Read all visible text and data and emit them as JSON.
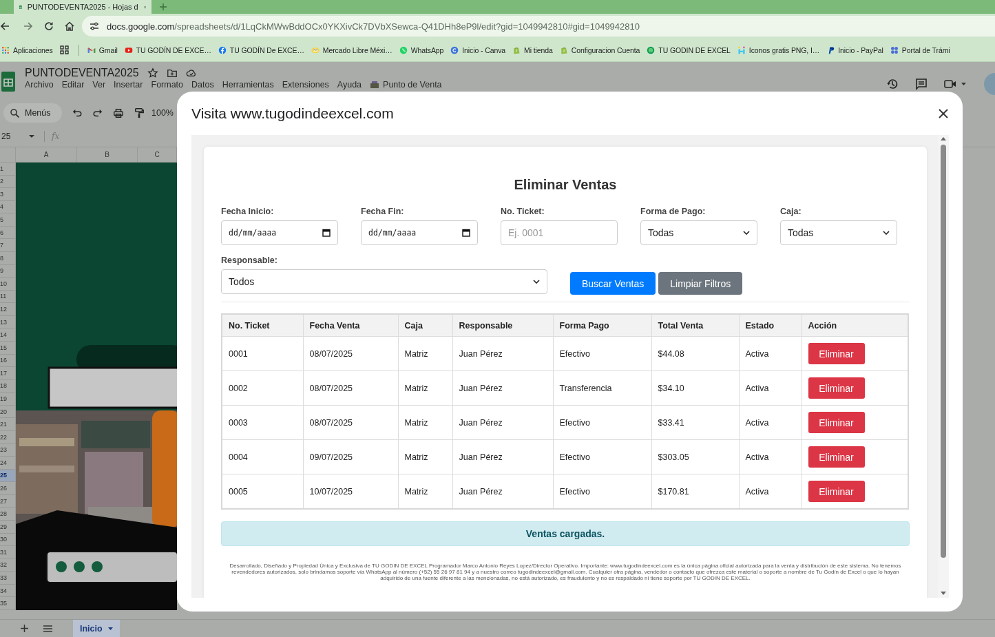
{
  "browser": {
    "tab_title": "PUNTODEVENTA2025 - Hojas d",
    "url_host": "docs.google.com",
    "url_path": "/spreadsheets/d/1LqCkMWwBddOCx0YKXivCk7DVbXSewca-Q41DHh8eP9l/edit?gid=1049942810#gid=1049942810",
    "bookmarks": [
      "Aplicaciones",
      "Gmail",
      "TU GODÍN DE EXCE…",
      "TU GODÍN De EXCE…",
      "Mercado Libre Méxi…",
      "WhatsApp",
      "Inicio - Canva",
      "Mi tienda",
      "Configuracion Cuenta",
      "TU GODIN DE EXCEL",
      "Iconos gratis PNG, I…",
      "Inicio - PayPal",
      "Portal de Trámi"
    ]
  },
  "spreadsheet": {
    "title": "PUNTODEVENTA2025",
    "menus": [
      "Archivo",
      "Editar",
      "Ver",
      "Insertar",
      "Formato",
      "Datos",
      "Herramientas",
      "Extensiones",
      "Ayuda"
    ],
    "custom_menu": "Punto de Venta",
    "search_label": "Menús",
    "zoom": "100%",
    "cell_ref": "25",
    "formula_label": "fx",
    "columns": [
      "A",
      "B",
      "C"
    ],
    "rows": [
      {
        "label": "1",
        "selected": false
      },
      {
        "label": "2",
        "selected": false
      },
      {
        "label": "3",
        "selected": false
      },
      {
        "label": "4",
        "selected": false
      },
      {
        "label": "5",
        "selected": false
      },
      {
        "label": "6",
        "selected": false
      },
      {
        "label": "7",
        "selected": false
      },
      {
        "label": "8",
        "selected": false
      },
      {
        "label": "9",
        "selected": false
      },
      {
        "label": "10",
        "selected": false
      },
      {
        "label": "11",
        "selected": false
      },
      {
        "label": "12",
        "selected": false
      },
      {
        "label": "13",
        "selected": false
      },
      {
        "label": "14",
        "selected": false
      },
      {
        "label": "15",
        "selected": false
      },
      {
        "label": "16",
        "selected": false
      },
      {
        "label": "17",
        "selected": false
      },
      {
        "label": "18",
        "selected": false
      },
      {
        "label": "19",
        "selected": false
      },
      {
        "label": "20",
        "selected": false
      },
      {
        "label": "21",
        "selected": false
      },
      {
        "label": "22",
        "selected": false
      },
      {
        "label": "23",
        "selected": false
      },
      {
        "label": "24",
        "selected": false
      },
      {
        "label": "25",
        "selected": true
      },
      {
        "label": "26",
        "selected": false
      },
      {
        "label": "27",
        "selected": false
      },
      {
        "label": "28",
        "selected": false
      },
      {
        "label": "29",
        "selected": false
      },
      {
        "label": "30",
        "selected": false
      },
      {
        "label": "31",
        "selected": false
      },
      {
        "label": "32",
        "selected": false
      },
      {
        "label": "33",
        "selected": false
      },
      {
        "label": "34",
        "selected": false
      },
      {
        "label": "35",
        "selected": false
      }
    ],
    "sheet_tabs": [
      {
        "label": "Inicio",
        "selected": true
      }
    ]
  },
  "dialog": {
    "title": "Visita www.tugodindeexcel.com",
    "panel": {
      "heading": "Eliminar Ventas",
      "filters": [
        {
          "label": "Fecha Inicio:",
          "kind": "date",
          "value": "dd/mm/aaaa"
        },
        {
          "label": "Fecha Fin:",
          "kind": "date",
          "value": "dd/mm/aaaa"
        },
        {
          "label": "No. Ticket:",
          "kind": "text",
          "placeholder": "Ej. 0001"
        },
        {
          "label": "Forma de Pago:",
          "kind": "select",
          "value": "Todas"
        },
        {
          "label": "Caja:",
          "kind": "select",
          "value": "Todas"
        }
      ],
      "responsible_filter": {
        "label": "Responsable:",
        "kind": "select",
        "value": "Todos"
      },
      "buttons": [
        {
          "label": "Buscar Ventas",
          "kind": "primary"
        },
        {
          "label": "Limpiar Filtros",
          "kind": "secondary"
        }
      ],
      "table": {
        "columns": [
          "No. Ticket",
          "Fecha Venta",
          "Caja",
          "Responsable",
          "Forma Pago",
          "Total Venta",
          "Estado",
          "Acción"
        ],
        "rows": [
          {
            "cells": [
              "0001",
              "08/07/2025",
              "Matriz",
              "Juan Pérez",
              "Efectivo",
              "$44.08",
              "Activa"
            ],
            "action": "Eliminar"
          },
          {
            "cells": [
              "0002",
              "08/07/2025",
              "Matriz",
              "Juan Pérez",
              "Transferencia",
              "$34.10",
              "Activa"
            ],
            "action": "Eliminar"
          },
          {
            "cells": [
              "0003",
              "08/07/2025",
              "Matriz",
              "Juan Pérez",
              "Efectivo",
              "$33.41",
              "Activa"
            ],
            "action": "Eliminar"
          },
          {
            "cells": [
              "0004",
              "09/07/2025",
              "Matriz",
              "Juan Pérez",
              "Efectivo",
              "$303.05",
              "Activa"
            ],
            "action": "Eliminar"
          },
          {
            "cells": [
              "0005",
              "10/07/2025",
              "Matriz",
              "Juan Pérez",
              "Efectivo",
              "$170.81",
              "Activa"
            ],
            "action": "Eliminar"
          }
        ]
      },
      "status_message": "Ventas cargadas.",
      "footer": "Desarrollado, Diseñado y Propiedad Única y Exclusiva de TU GODIN DE EXCEL Programador Marco Antonio Reyes Lopez/Director Operativo. Importante: www.tugodindeexcel.com es la única página oficial autorizada para la venta y distribución de este sistema. No tenemos revendedores autorizados, solo brindamos soporte vía WhatsApp al número (+52) 55 26 97 81 94 y a nuestro correo tugodindeexcel@gmail.com. Cualquier otra página, vendedor o contacto que ofrezca este material o soporte a nombre de Tu Godín de Excel o que lo hayan adquirido de una fuente diferente a las mencionadas, no está autorizado, es fraudulento y no es respaldado ni tiene soporte por TU GODIN DE EXCEL."
    }
  }
}
